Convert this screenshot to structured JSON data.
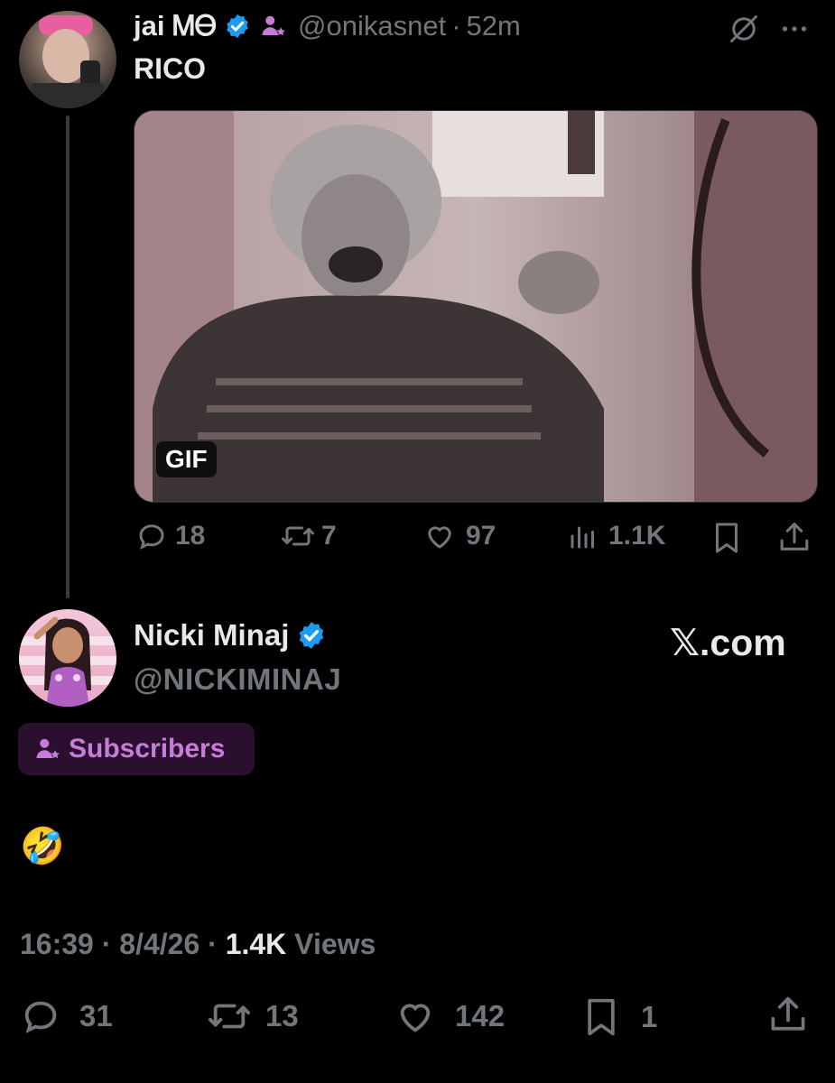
{
  "reply": {
    "display_name": "jai ᎷᎾ",
    "handle": "@onikasnet",
    "separator": "·",
    "time": "52m",
    "text": "RICO",
    "media_badge": "GIF",
    "actions": {
      "replies": "18",
      "reposts": "7",
      "likes": "97",
      "views": "1.1K"
    }
  },
  "main": {
    "display_name": "Nicki Minaj",
    "handle": "@NICKIMINAJ",
    "watermark": "𝕏.com",
    "subscribers_label": "Subscribers",
    "text": "🤣",
    "meta": {
      "time": "16:39",
      "sep1": "·",
      "date": "8/4/26",
      "sep2": "·",
      "views_count": "1.4K",
      "views_label": "Views"
    },
    "actions": {
      "replies": "31",
      "reposts": "13",
      "likes": "142",
      "bookmarks": "1"
    }
  },
  "colors": {
    "background": "#000000",
    "text_primary": "#e7e9ea",
    "text_muted": "#71767b",
    "verified_blue": "#1d9bf0",
    "subscriber_purple": "#c77dd8",
    "subscriber_pill_bg": "#2b0f2f"
  },
  "icons": [
    "verified-badge-icon",
    "subscriber-icon",
    "grok-icon",
    "more-icon",
    "reply-icon",
    "repost-icon",
    "like-icon",
    "views-icon",
    "bookmark-icon",
    "share-icon"
  ]
}
